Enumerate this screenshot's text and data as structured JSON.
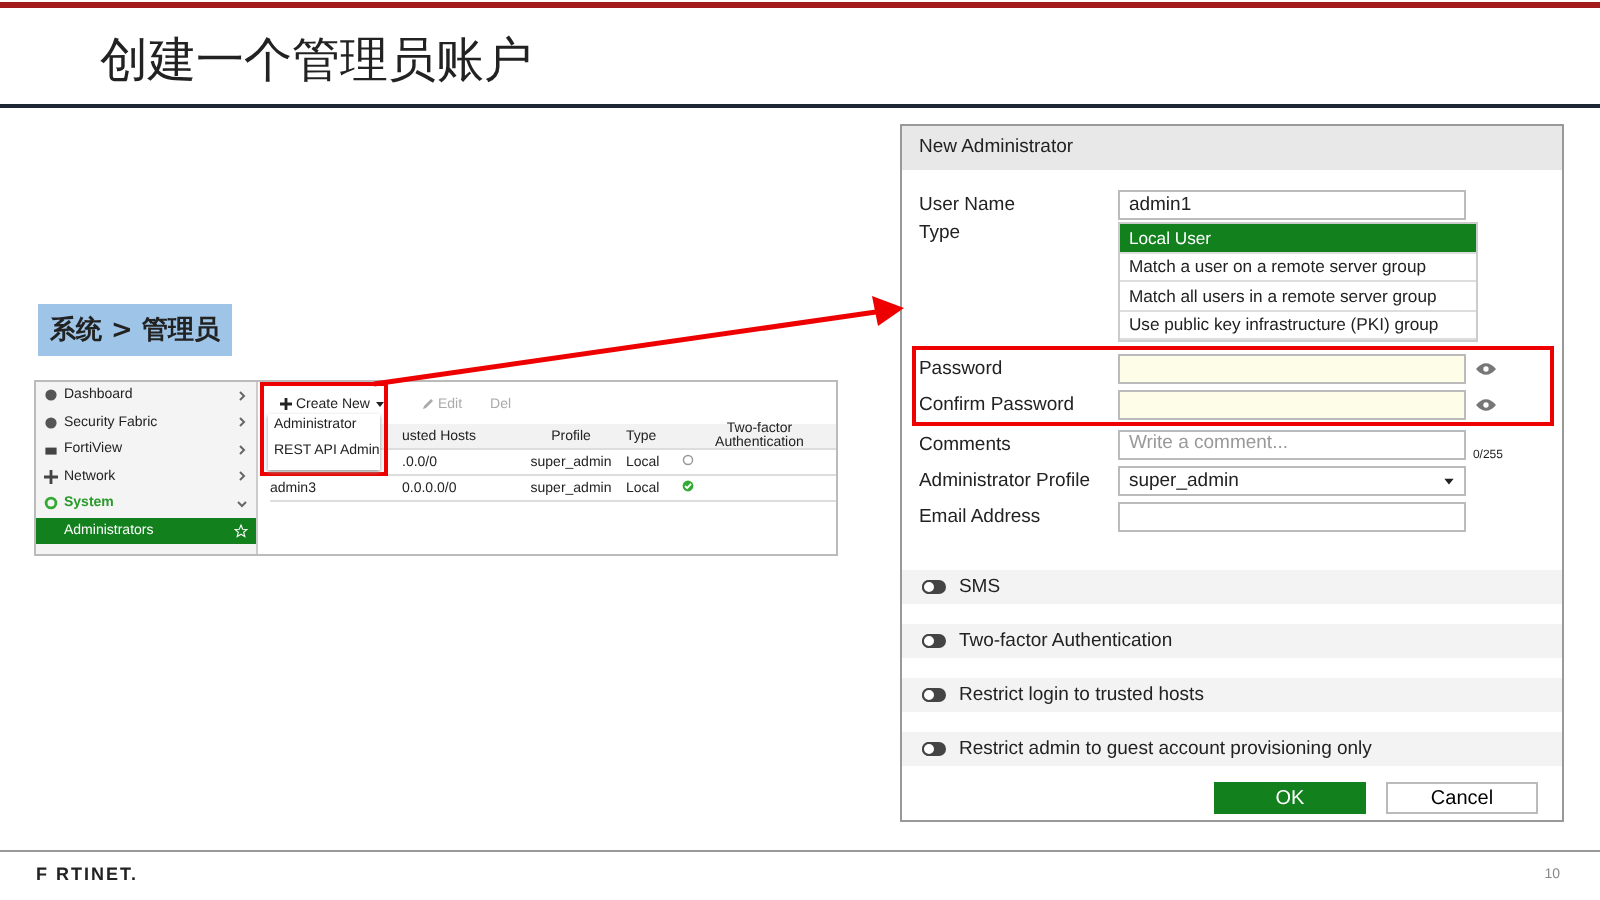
{
  "title": "创建一个管理员账户",
  "breadcrumb": "系统 > 管理员",
  "sidebar": {
    "items": [
      {
        "label": "Dashboard",
        "expanded": false,
        "selected": false
      },
      {
        "label": "Security Fabric",
        "expanded": false,
        "selected": false
      },
      {
        "label": "FortiView",
        "expanded": false,
        "selected": false
      },
      {
        "label": "Network",
        "expanded": false,
        "selected": false
      },
      {
        "label": "System",
        "expanded": true,
        "selected": true,
        "children": [
          {
            "label": "Administrators",
            "selected": true
          }
        ]
      }
    ]
  },
  "toolbar": {
    "create": "Create New",
    "edit": "Edit",
    "delete": "Del"
  },
  "create_menu": [
    "Administrator",
    "REST API Admin"
  ],
  "table": {
    "columns": [
      "usted Hosts",
      "Profile",
      "Type",
      "Two-factor Authentication"
    ],
    "rows": [
      {
        "hosts": ".0.0/0",
        "profile": "super_admin",
        "type": "Local",
        "two_factor": false
      },
      {
        "name": "admin3",
        "hosts": "0.0.0.0/0",
        "profile": "super_admin",
        "type": "Local",
        "two_factor": true
      }
    ]
  },
  "dialog": {
    "title": "New Administrator",
    "user_name": {
      "label": "User Name",
      "value": "admin1"
    },
    "type": {
      "label": "Type",
      "options": [
        {
          "label": "Local User",
          "selected": true
        },
        {
          "label": "Match a user on a remote server group",
          "selected": false
        },
        {
          "label": "Match all users in a remote server group",
          "selected": false
        },
        {
          "label": "Use public key infrastructure (PKI) group",
          "selected": false
        }
      ]
    },
    "password": {
      "label": "Password"
    },
    "confirm_password": {
      "label": "Confirm Password"
    },
    "comments": {
      "label": "Comments",
      "placeholder": "Write a comment...",
      "counter": "0/255"
    },
    "profile": {
      "label": "Administrator Profile",
      "value": "super_admin"
    },
    "email": {
      "label": "Email Address"
    },
    "toggles": [
      {
        "label": "SMS",
        "on": false
      },
      {
        "label": "Two-factor Authentication",
        "on": false
      },
      {
        "label": "Restrict login to trusted hosts",
        "on": false
      },
      {
        "label": "Restrict admin to guest account provisioning only",
        "on": false
      }
    ],
    "buttons": [
      "OK",
      "Cancel"
    ]
  },
  "footer": {
    "logo": "F RTINET.",
    "page": "10"
  }
}
